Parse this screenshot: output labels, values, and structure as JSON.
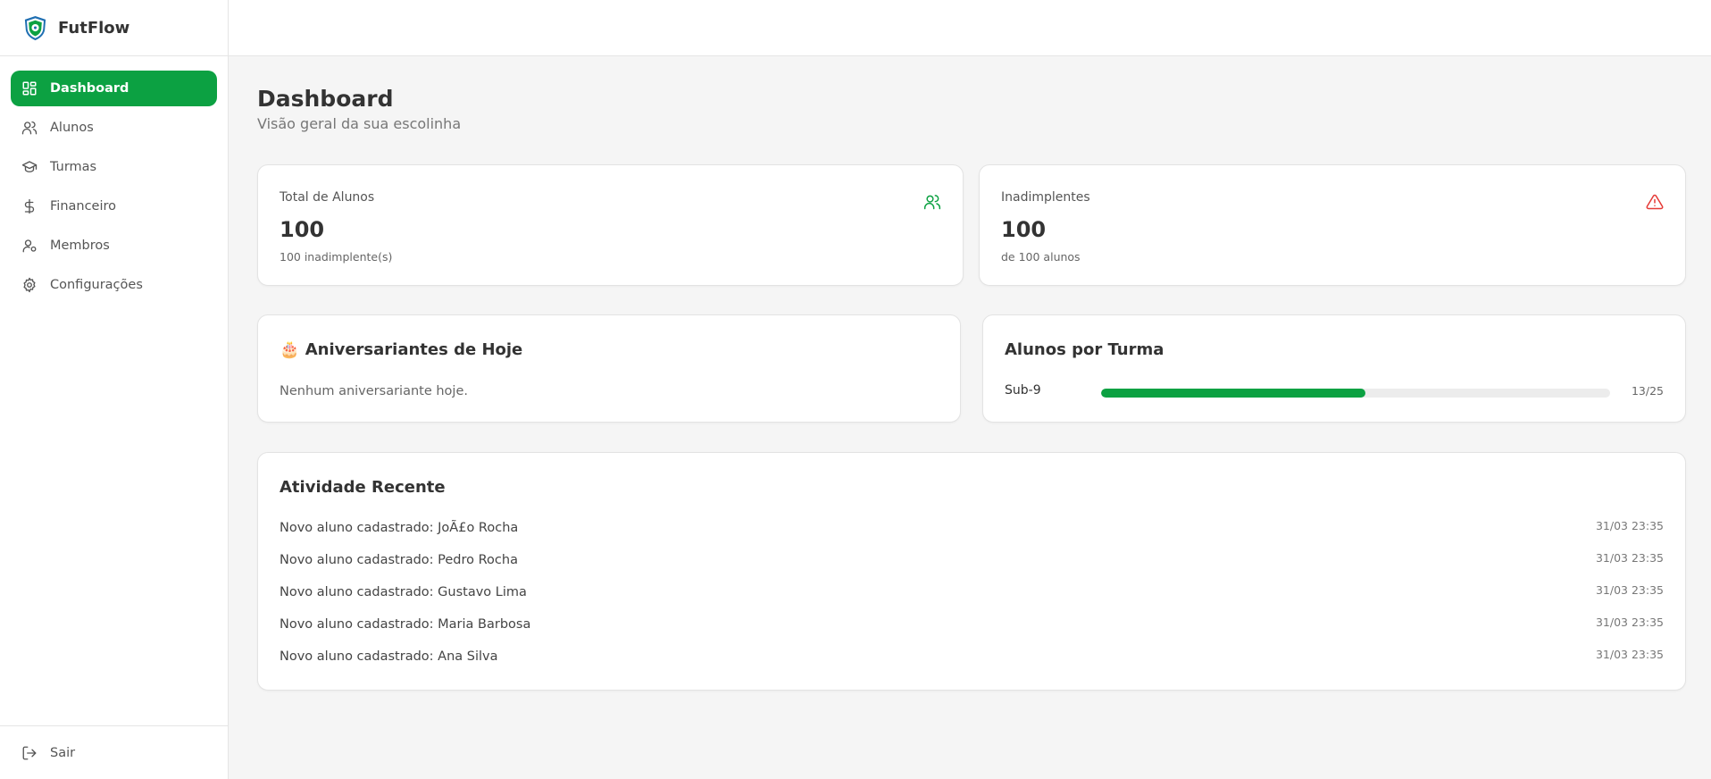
{
  "brand": {
    "name": "FutFlow"
  },
  "sidebar": {
    "items": [
      {
        "label": "Dashboard",
        "icon": "dashboard-icon",
        "active": true
      },
      {
        "label": "Alunos",
        "icon": "users-icon"
      },
      {
        "label": "Turmas",
        "icon": "graduation-cap-icon"
      },
      {
        "label": "Financeiro",
        "icon": "dollar-icon"
      },
      {
        "label": "Membros",
        "icon": "user-settings-icon"
      },
      {
        "label": "Configurações",
        "icon": "gear-icon"
      }
    ],
    "logout_label": "Sair"
  },
  "page": {
    "title": "Dashboard",
    "subtitle": "Visão geral da sua escolinha"
  },
  "stats": {
    "total": {
      "label": "Total de Alunos",
      "value": "100",
      "sub": "100 inadimplente(s)",
      "icon": "users-icon",
      "color": "#0ca142"
    },
    "overdue": {
      "label": "Inadimplentes",
      "value": "100",
      "sub": "de 100 alunos",
      "icon": "alert-triangle-icon",
      "color": "#e53935"
    }
  },
  "birthdays": {
    "emoji": "🎂",
    "title": "Aniversariantes de Hoje",
    "empty": "Nenhum aniversariante hoje."
  },
  "turmas": {
    "title": "Alunos por Turma",
    "rows": [
      {
        "name": "Sub-9",
        "count": "13/25",
        "current": 13,
        "max": 25
      }
    ]
  },
  "activity": {
    "title": "Atividade Recente",
    "items": [
      {
        "text": "Novo aluno cadastrado: JoÃ£o Rocha",
        "time": "31/03 23:35"
      },
      {
        "text": "Novo aluno cadastrado: Pedro Rocha",
        "time": "31/03 23:35"
      },
      {
        "text": "Novo aluno cadastrado: Gustavo Lima",
        "time": "31/03 23:35"
      },
      {
        "text": "Novo aluno cadastrado: Maria Barbosa",
        "time": "31/03 23:35"
      },
      {
        "text": "Novo aluno cadastrado: Ana Silva",
        "time": "31/03 23:35"
      }
    ]
  },
  "colors": {
    "accent": "#0ca142",
    "danger": "#e53935"
  }
}
